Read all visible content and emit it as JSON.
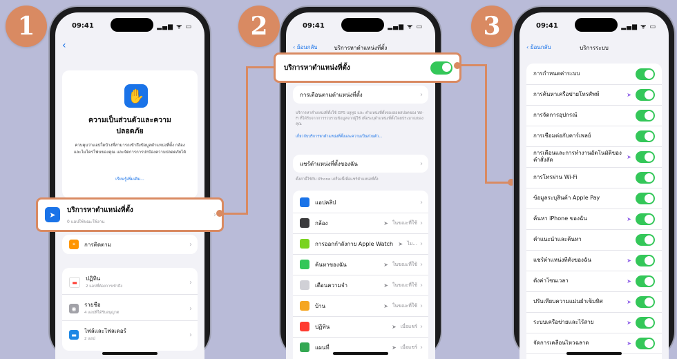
{
  "badges": [
    "1",
    "2",
    "3"
  ],
  "status": {
    "time": "09:41",
    "icons": "▂▄▆ ᯤ ▭"
  },
  "phone1": {
    "header_title": "ความเป็นส่วนตัวและความปลอดภัย",
    "header_desc": "ควบคุมว่าแอปใดบ้างที่สามารถเข้าถึงข้อมูลตำแหน่งที่ตั้ง กล้อง และไมโครโฟนของคุณ และจัดการการปกป้องความปลอดภัยได้",
    "header_link": "เรียนรู้เพิ่มเติม...",
    "highlight": {
      "label": "บริการหาตำแหน่งที่ตั้ง",
      "sub": "0 แอปใช้ขณะใช้งาน"
    },
    "tracking": "การติดตาม",
    "apps": [
      {
        "label": "ปฏิทิน",
        "sub": "2 แอปที่ต้องการเข้าถึง"
      },
      {
        "label": "รายชื่อ",
        "sub": "4 แอปที่ได้รับอนุญาต"
      },
      {
        "label": "ไฟล์และโฟลเดอร์",
        "sub": "2 แอป"
      }
    ]
  },
  "phone2": {
    "back": "ย้อนกลับ",
    "title": "บริการหาตำแหน่งที่ตั้ง",
    "toggle_label": "บริการหาตำแหน่งที่ตั้ง",
    "alerts": "การเตือนตามตำแหน่งที่ตั้ง",
    "note1": "บริการหาตำแหน่งที่ตั้งใช้ GPS บลูทูธ และ ตำแหน่งที่ตั้งของฮอตสปอตของ Wi-Fi ที่ได้รับจากการรวบรวมข้อมูลจากผู้ใช้ เพื่อระบุตำแหน่งที่ตั้งโดยประมาณของคุณ",
    "note1_link": "เกี่ยวกับบริการหาตำแหน่งที่ตั้งและความเป็นส่วนตัว...",
    "share": "แชร์ตำแหน่งที่ตั้งของฉัน",
    "note2": "ตั้งค่านี้ใช้กับ iPhone เครื่องนี้เพื่อแชร์ตำแหน่งที่ตั้ง",
    "apps": [
      {
        "label": "แอปคลิป",
        "value": ""
      },
      {
        "label": "กล้อง",
        "value": "ในขณะที่ใช้"
      },
      {
        "label": "การออกกำลังกาย Apple Watch",
        "value": "ไม..."
      },
      {
        "label": "ค้นหาของฉัน",
        "value": "ในขณะที่ใช้"
      },
      {
        "label": "เตือนความจำ",
        "value": "ในขณะที่ใช้"
      },
      {
        "label": "บ้าน",
        "value": "ในขณะที่ใช้"
      },
      {
        "label": "ปฏิทิน",
        "value": "เมื่อแชร์"
      },
      {
        "label": "แผนที่",
        "value": "เมื่อแชร์"
      }
    ],
    "app_colors": [
      "#1a73e8",
      "#3a3a3c",
      "#7ad321",
      "#34c759",
      "#d0d0d6",
      "#f5a623",
      "#ff3b30",
      "#34a853"
    ]
  },
  "phone3": {
    "back": "ย้อนกลับ",
    "title": "บริการระบบ",
    "rows": [
      "การกำหนดค่าระบบ",
      "การค้นหาเครือข่ายโทรศัพท์",
      "การจัดการอุปกรณ์",
      "การเชื่อมต่อกับคาร์เพลย์",
      "การเตือนและการทำงานอัตโนมัติของคำสั่งลัด",
      "การโทรผ่าน Wi-Fi",
      "ข้อมูลระบุสินค้า Apple Pay",
      "ค้นหา iPhone ของฉัน",
      "คำแนะนำและค้นหา",
      "แชร์ตำแหน่งที่ตั้งของฉัน",
      "ตั้งค่าโซนเวลา",
      "ปรับเทียบความแม่นยำเข็มทิศ",
      "ระบบเครือข่ายและไร้สาย",
      "จัดการเคลื่อนไหวฉลาด"
    ],
    "arrows": [
      false,
      true,
      false,
      false,
      true,
      false,
      false,
      true,
      false,
      true,
      true,
      true,
      true,
      true
    ]
  },
  "accent": "#d98a62",
  "toggle_on": "#34c759"
}
